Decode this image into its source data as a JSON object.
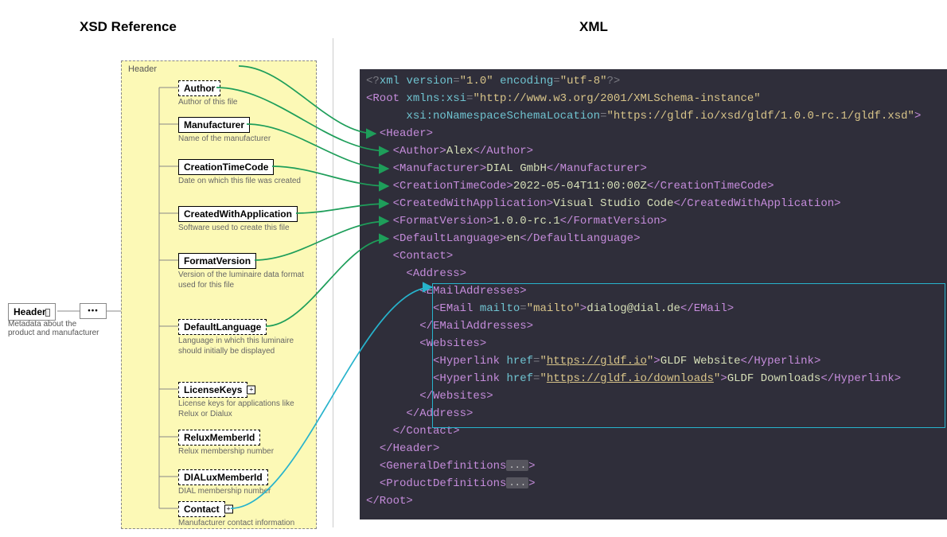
{
  "titles": {
    "left": "XSD Reference",
    "right": "XML"
  },
  "root": {
    "label": "Header",
    "desc": "Metadata about the product and manufacturer"
  },
  "header_group_title": "Header",
  "xsd_items": [
    {
      "key": "author",
      "label": "Author",
      "desc": "Author of this file",
      "dashed": true
    },
    {
      "key": "manufacturer",
      "label": "Manufacturer",
      "desc": "Name of the manufacturer"
    },
    {
      "key": "creation",
      "label": "CreationTimeCode",
      "desc": "Date on which this file was created"
    },
    {
      "key": "createdwith",
      "label": "CreatedWithApplication",
      "desc": "Software used to create this file"
    },
    {
      "key": "formatversion",
      "label": "FormatVersion",
      "desc": "Version of the luminaire data format used for this file"
    },
    {
      "key": "defaultlang",
      "label": "DefaultLanguage",
      "desc": "Language in which this luminaire should initially be displayed",
      "dashed": true
    },
    {
      "key": "licensekeys",
      "label": "LicenseKeys",
      "desc": "License keys for applications like Relux or Dialux",
      "dashed": true,
      "plus": true
    },
    {
      "key": "reluxmember",
      "label": "ReluxMemberId",
      "desc": "Relux membership number",
      "dashed": true
    },
    {
      "key": "dialuxmember",
      "label": "DIALuxMemberId",
      "desc": "DIAL membership number",
      "dashed": true
    },
    {
      "key": "contact",
      "label": "Contact",
      "desc": "Manufacturer contact information",
      "dashed": true,
      "plus": true
    }
  ],
  "xml": {
    "indent": "  ",
    "decl_version": "1.0",
    "decl_encoding": "utf-8",
    "ns_prefix": "xmlns:xsi",
    "ns_url": "http://www.w3.org/2001/XMLSchema-instance",
    "schemaloc_attr": "xsi:noNamespaceSchemaLocation",
    "schemaloc_url": "https://gldf.io/xsd/gldf/1.0.0-rc.1/gldf.xsd",
    "root_tag": "Root",
    "header_tag": "Header",
    "author": "Alex",
    "manufacturer": "DIAL GmbH",
    "creation": "2022-05-04T11:00:00Z",
    "createdwith": "Visual Studio Code",
    "formatversion": "1.0.0-rc.1",
    "defaultlang": "en",
    "contact_tag": "Contact",
    "address_tag": "Address",
    "emailaddresses_tag": "EMailAddresses",
    "email_tag": "EMail",
    "email_attr_name": "mailto",
    "email_attr_val": "mailto",
    "email_text": "dialog@dial.de",
    "websites_tag": "Websites",
    "hyperlink_tag": "Hyperlink",
    "href_attr": "href",
    "link1_url": "https://gldf.io",
    "link1_text": "GLDF Website",
    "link2_url": "https://gldf.io/downloads",
    "link2_text": "GLDF Downloads",
    "gendef_tag": "GeneralDefinitions",
    "proddef_tag": "ProductDefinitions",
    "ellipsis": "..."
  }
}
